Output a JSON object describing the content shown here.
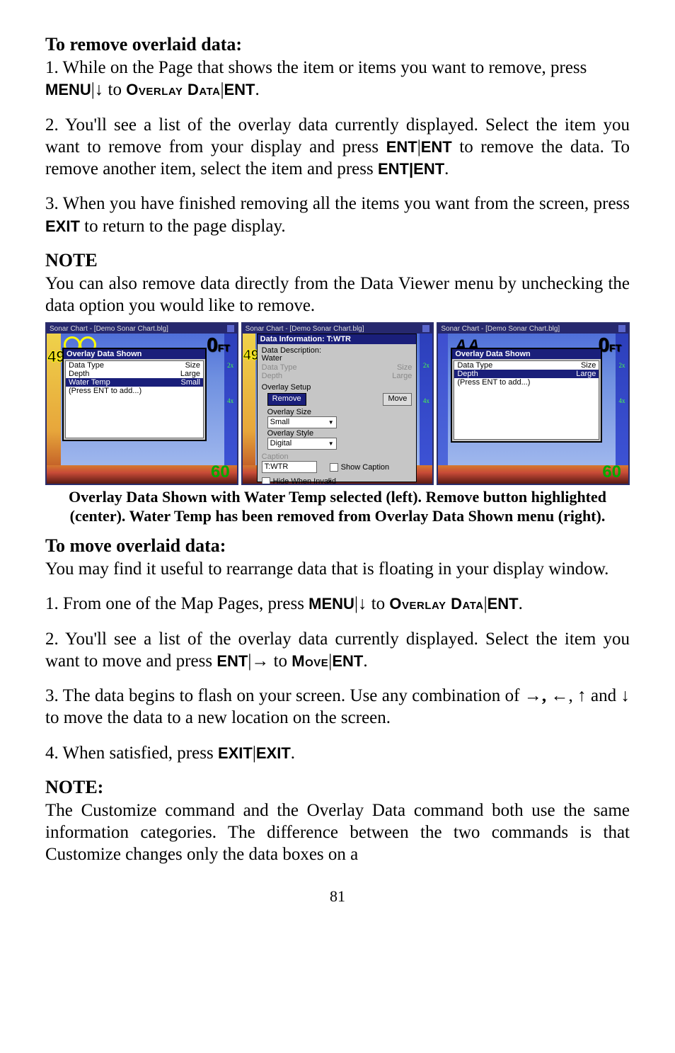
{
  "sections": {
    "removeTitle": "To remove overlaid data:",
    "step1a": "1. While on the Page that shows the item or items you want to remove, press ",
    "menu": "MENU",
    "pipe": "|",
    "downArrow": "↓",
    "to": " to ",
    "overlayData": "Overlay Data",
    "ent": "ENT",
    "period": ".",
    "step2a": "2. You'll see a list of the overlay data currently displayed. Select the item you want to remove from your display and press ",
    "entent": "ENT|ENT",
    "step2b": " to remove the data. To remove another item, select the item and press ",
    "step3a": "3. When you have finished removing all the items you want from the screen, press ",
    "exit": "EXIT",
    "step3b": " to return to the page display.",
    "noteTitle": "NOTE",
    "noteBody": "You can also remove data directly from the Data Viewer menu by unchecking the data option you would like to remove.",
    "caption": "Overlay Data Shown with Water Temp selected (left). Remove button highlighted (center). Water Temp has been removed from  Overlay Data Shown menu (right).",
    "moveTitle": "To move overlaid data:",
    "moveIntro": "You may find it useful to rearrange data that is floating in your display window.",
    "moveStep1a": "1. From one of the Map Pages, press ",
    "moveStep2a": "2. You'll see a list of the overlay data currently displayed. Select the item you want to move and press ",
    "rightArrow": "→",
    "move": "Move",
    "moveStep3a": "3. The data begins to flash on your screen. Use any combination of ",
    "comma": ",",
    "leftArrow": "←",
    "upArrow": "↑",
    "and": " and ",
    "moveStep3b": " to move the data to a new location on the screen.",
    "moveStep4a": "4. When satisfied, press ",
    "exitexit": "EXIT|EXIT",
    "note2Title": "NOTE:",
    "note2Body": "The Customize command and the Overlay Data command both use the same information categories. The difference between the two commands is that Customize changes only the data boxes on a",
    "pageNum": "81"
  },
  "shots": {
    "titlebar": "Sonar Chart - [Demo Sonar Chart.blg]",
    "zero": "0",
    "sixty": "60",
    "fortynine": "49",
    "left": {
      "hdr": "Overlay Data Shown",
      "col1": "Size",
      "rows": [
        {
          "label": "Data Type",
          "size": "Size"
        },
        {
          "label": "Depth",
          "size": "Large"
        },
        {
          "label": "Water Temp",
          "size": "Small",
          "sel": true
        },
        {
          "label": "(Press ENT to add...)",
          "size": ""
        }
      ]
    },
    "center": {
      "hdr": "Data Information: T:WTR",
      "desc": "Data Description:",
      "water": "Water",
      "dim1": "Data Type",
      "dim1s": "Size",
      "dim2": "Depth",
      "dim2s": "Large",
      "setup": "Overlay Setup",
      "remove": "Remove",
      "moveBtn": "Move",
      "oSize": "Overlay Size",
      "small": "Small",
      "oStyle": "Overlay Style",
      "digital": "Digital",
      "capLbl": "Caption",
      "capVal": "T:WTR",
      "showCap": "Show Caption",
      "hideInv": "Hide When Invalid"
    },
    "right": {
      "hdr": "Overlay Data Shown",
      "rows": [
        {
          "label": "Data Type",
          "size": "Size"
        },
        {
          "label": "Depth",
          "size": "Large",
          "sel": true
        },
        {
          "label": "(Press ENT to add...)",
          "size": ""
        }
      ]
    },
    "tick2x": "2x",
    "tick4x": "4x"
  }
}
